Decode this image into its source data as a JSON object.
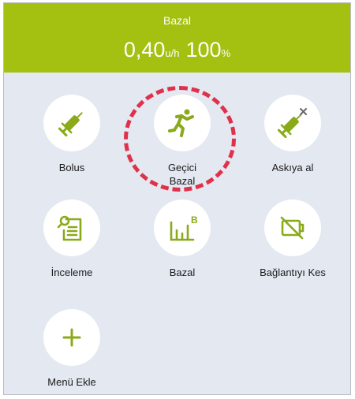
{
  "header": {
    "title": "Bazal",
    "rate_value": "0,40",
    "rate_unit": "u/h",
    "percent_value": "100",
    "percent_unit": "%"
  },
  "tiles": [
    {
      "label": "Bolus",
      "icon": "syringe-icon"
    },
    {
      "label": "Geçici\nBazal",
      "icon": "running-person-icon",
      "highlighted": true
    },
    {
      "label": "Askıya al",
      "icon": "syringe-cross-icon"
    },
    {
      "label": "İnceleme",
      "icon": "document-search-icon"
    },
    {
      "label": "Bazal",
      "icon": "basal-chart-icon"
    },
    {
      "label": "Bağlantıyı Kes",
      "icon": "disconnect-icon"
    },
    {
      "label": "Menü Ekle",
      "icon": "plus-icon"
    }
  ],
  "colors": {
    "accent": "#a4c011",
    "background": "#e3e8f1",
    "highlight": "#e0304a"
  }
}
